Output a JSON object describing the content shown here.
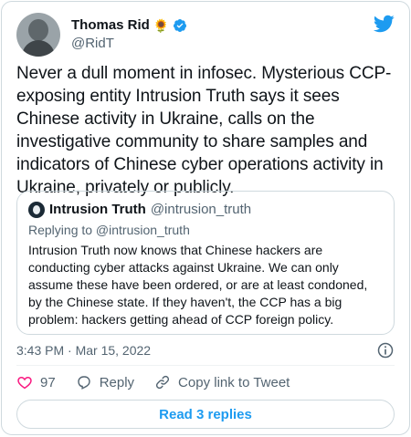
{
  "author": {
    "display_name": "Thomas Rid",
    "emoji": "🌻",
    "handle": "@RidT"
  },
  "tweet": {
    "text": "Never a dull moment in infosec. Mysterious CCP-exposing entity Intrusion Truth says it sees Chinese activity in Ukraine, calls on the investigative community to share samples and indicators of Chinese cyber operations activity in Ukraine, privately or publicly."
  },
  "quoted": {
    "display_name": "Intrusion Truth",
    "handle": "@intrusion_truth",
    "replying_to": "Replying to @intrusion_truth",
    "text": "Intrusion Truth now knows that Chinese hackers are conducting cyber attacks against Ukraine. We can only assume these have been ordered, or are at least condoned, by the Chinese state. If they haven't, the CCP has a big problem: hackers getting ahead of CCP foreign policy."
  },
  "meta": {
    "timestamp": "3:43 PM · Mar 15, 2022"
  },
  "actions": {
    "like_count": "97",
    "reply_label": "Reply",
    "copy_label": "Copy link to Tweet"
  },
  "read_replies": "Read 3 replies",
  "colors": {
    "accent": "#1d9bf0",
    "like": "#f91880",
    "text": "#0f1419",
    "muted": "#536471",
    "border": "#cfd9de"
  },
  "icons": [
    "twitter-bird-icon",
    "verified-badge-icon",
    "info-icon",
    "heart-icon",
    "reply-icon",
    "link-icon"
  ]
}
